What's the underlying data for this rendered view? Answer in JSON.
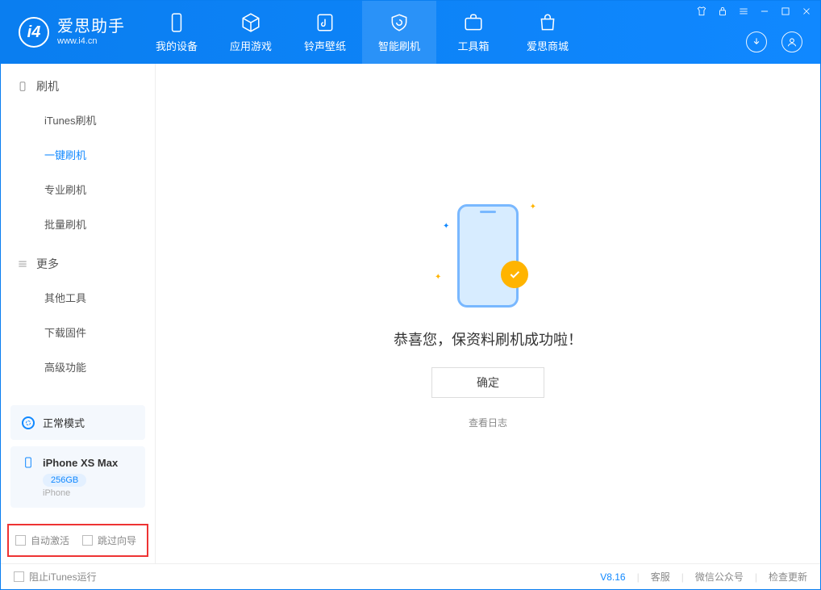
{
  "app": {
    "title": "爱思助手",
    "subtitle": "www.i4.cn"
  },
  "nav": {
    "items": [
      {
        "label": "我的设备"
      },
      {
        "label": "应用游戏"
      },
      {
        "label": "铃声壁纸"
      },
      {
        "label": "智能刷机"
      },
      {
        "label": "工具箱"
      },
      {
        "label": "爱思商城"
      }
    ]
  },
  "sidebar": {
    "group1": {
      "title": "刷机",
      "items": [
        "iTunes刷机",
        "一键刷机",
        "专业刷机",
        "批量刷机"
      ],
      "activeIndex": 1
    },
    "group2": {
      "title": "更多",
      "items": [
        "其他工具",
        "下载固件",
        "高级功能"
      ]
    },
    "mode": "正常模式",
    "device": {
      "name": "iPhone XS Max",
      "capacity": "256GB",
      "type": "iPhone"
    },
    "options": {
      "autoActivate": "自动激活",
      "skipGuide": "跳过向导"
    }
  },
  "main": {
    "successText": "恭喜您，保资料刷机成功啦！",
    "okLabel": "确定",
    "viewLogLabel": "查看日志"
  },
  "footer": {
    "blockItunes": "阻止iTunes运行",
    "version": "V8.16",
    "links": [
      "客服",
      "微信公众号",
      "检查更新"
    ]
  }
}
